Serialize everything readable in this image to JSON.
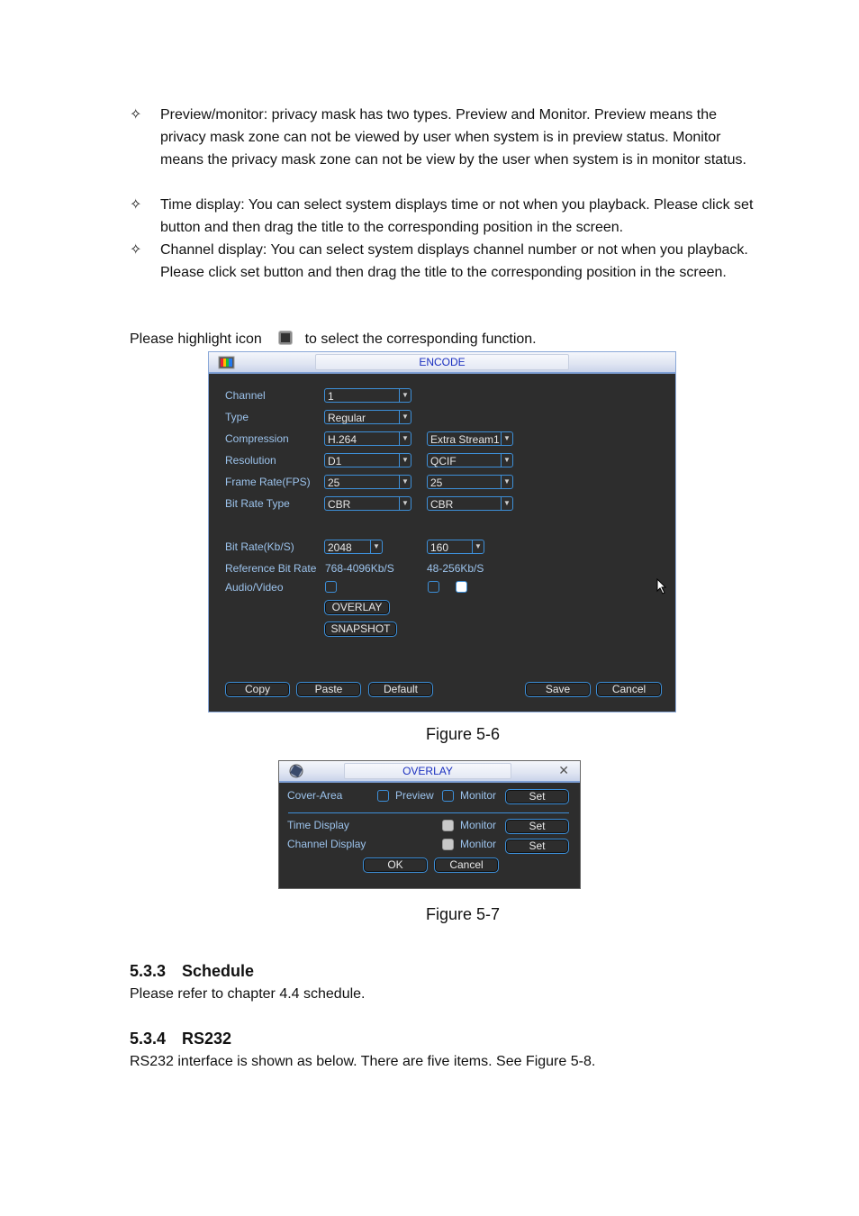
{
  "bullets": [
    {
      "icon": "diamond-star-icon",
      "glyph": "✧",
      "text": "Preview/monitor: privacy mask has two types. Preview and Monitor. Preview means the privacy mask zone can not be viewed by user when system is in preview status. Monitor means the privacy mask zone can not be view by the user when system is in monitor status."
    },
    {
      "icon": "diamond-star-icon",
      "glyph": "✧",
      "text": "Time display: You can select system displays time or not when you playback. Please click set button and then drag the title to the corresponding position in the screen."
    },
    {
      "icon": "diamond-star-icon",
      "glyph": "✧",
      "text": "Channel display: You can select system displays channel number or not when you playback. Please click set button and then drag the title to the corresponding position in the screen."
    }
  ],
  "highlight_sentence": {
    "before": "Please highlight icon",
    "icon": "highlight-square-icon",
    "after": "to select the corresponding function."
  },
  "encode_dialog": {
    "title": "ENCODE",
    "icon": "color-bars-icon",
    "labels": {
      "channel": "Channel",
      "type": "Type",
      "compression": "Compression",
      "resolution": "Resolution",
      "frame_rate": "Frame Rate(FPS)",
      "bit_rate_type": "Bit Rate Type",
      "bit_rate": "Bit Rate(Kb/S)",
      "reference_bit_rate": "Reference Bit Rate",
      "audio_video": "Audio/Video"
    },
    "main_stream": {
      "channel": "1",
      "type": "Regular",
      "compression": "H.264",
      "resolution": "D1",
      "frame_rate": "25",
      "bit_rate_type": "CBR",
      "bit_rate": "2048",
      "reference_bit_rate": "768-4096Kb/S",
      "audio_video_checked": false
    },
    "extra_stream": {
      "compression": "Extra Stream1",
      "resolution": "QCIF",
      "frame_rate": "25",
      "bit_rate_type": "CBR",
      "bit_rate": "160",
      "reference_bit_rate": "48-256Kb/S",
      "audio_checked": false,
      "video_checked": true
    },
    "buttons": {
      "overlay": "OVERLAY",
      "snapshot": "SNAPSHOT",
      "copy": "Copy",
      "paste": "Paste",
      "default": "Default",
      "save": "Save",
      "cancel": "Cancel"
    },
    "colors": {
      "background": "#2d2d2d",
      "label": "#9cc3ec",
      "border": "#3d8fd8",
      "title": "#1a2fbf"
    }
  },
  "figure_5_6_caption": "Figure 5-6",
  "overlay_dialog": {
    "title": "OVERLAY",
    "icon": "film-reel-icon",
    "close_icon": "close-icon",
    "cover_area_label": "Cover-Area",
    "preview_label": "Preview",
    "monitor_label": "Monitor",
    "time_display_label": "Time Display",
    "channel_display_label": "Channel Display",
    "set_label": "Set",
    "ok_label": "OK",
    "cancel_label": "Cancel",
    "cover_preview_checked": false,
    "cover_monitor_checked": false,
    "time_monitor_checked": true,
    "channel_monitor_checked": true
  },
  "figure_5_7_caption": "Figure 5-7",
  "sections": [
    {
      "number": "5.3.3",
      "title": "Schedule",
      "body": "Please refer to chapter 4.4 schedule."
    },
    {
      "number": "5.3.4",
      "title": "RS232",
      "body": "RS232 interface is shown as below. There are five items. See Figure 5-8."
    }
  ]
}
